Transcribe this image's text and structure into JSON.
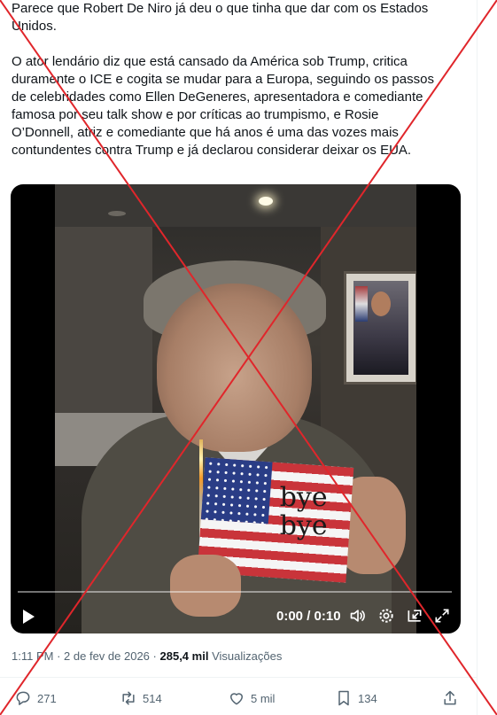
{
  "tweet": {
    "paragraph1": "Parece que Robert De Niro já deu o que tinha que dar com os Estados\nUnidos.",
    "paragraph2": "O ator lendário diz que está cansado da América sob Trump, critica\nduramente o ICE e cogita se mudar para a Europa, seguindo os passos\nde celebridades como Ellen DeGeneres, apresentadora e comediante\nfamosa por seu talk show e por críticas ao trumpismo, e Rosie\nO’Donnell, atriz e comediante que há anos é uma das vozes mais\ncontundentes contra Trump e já declarou considerar deixar os EUA."
  },
  "video": {
    "flag_text_line1": "bye",
    "flag_text_line2": "bye",
    "time": "0:00 / 0:10",
    "progress": 0,
    "icons": [
      "play-icon",
      "volume-icon",
      "settings-icon",
      "picture-in-picture-icon",
      "fullscreen-icon"
    ]
  },
  "meta": {
    "time": "1:11 PM",
    "separator1": "·",
    "date": "2 de fev de 2026",
    "separator2": "·",
    "views_count": "285,4 mil",
    "views_label": "Visualizações"
  },
  "actions": {
    "reply_count": "271",
    "retweet_count": "514",
    "like_count": "5 mil",
    "bookmark_count": "134"
  },
  "colors": {
    "text": "#0f1419",
    "muted": "#536471",
    "cross": "#e0262b"
  }
}
